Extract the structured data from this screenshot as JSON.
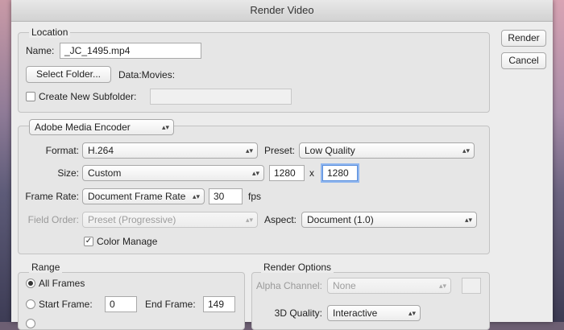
{
  "window": {
    "title": "Render Video"
  },
  "actions": {
    "render": "Render",
    "cancel": "Cancel"
  },
  "location": {
    "legend": "Location",
    "name_label": "Name:",
    "name_value": "_JC_1495.mp4",
    "select_folder": "Select Folder...",
    "folder_path": "Data:Movies:",
    "subfolder_label": "Create New Subfolder:",
    "subfolder_value": ""
  },
  "encoder": {
    "selected": "Adobe Media Encoder",
    "format_label": "Format:",
    "format_value": "H.264",
    "preset_label": "Preset:",
    "preset_value": "Low Quality",
    "size_label": "Size:",
    "size_value": "Custom",
    "width": "1280",
    "x": "x",
    "height": "1280",
    "frame_rate_label": "Frame Rate:",
    "frame_rate_value": "Document Frame Rate",
    "fps_value": "30",
    "fps_unit": "fps",
    "field_order_label": "Field Order:",
    "field_order_value": "Preset (Progressive)",
    "aspect_label": "Aspect:",
    "aspect_value": "Document (1.0)",
    "color_manage_label": "Color Manage",
    "color_manage_checked": true
  },
  "range": {
    "legend": "Range",
    "all_frames": "All Frames",
    "start_frame_label": "Start Frame:",
    "start_frame": "0",
    "end_frame_label": "End Frame:",
    "end_frame": "149"
  },
  "render_options": {
    "legend": "Render Options",
    "alpha_label": "Alpha Channel:",
    "alpha_value": "None",
    "quality_label": "3D Quality:",
    "quality_value": "Interactive"
  },
  "icons": {
    "check": "✓",
    "chevrons": "▴▾"
  }
}
